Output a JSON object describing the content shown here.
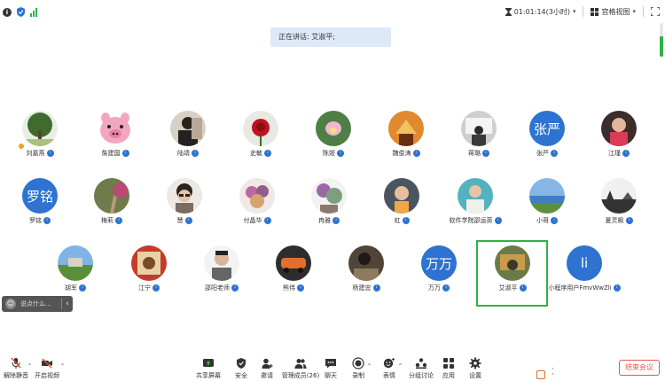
{
  "topbar": {
    "timer": "01:01:14(3小时)",
    "view_label": "宫格视图"
  },
  "speaker_label": "正在讲话: 艾淑平;",
  "participants": [
    {
      "name": "刘嘉燕",
      "avatar": "photo-tree",
      "host": true
    },
    {
      "name": "詹建国",
      "avatar": "pig-cartoon"
    },
    {
      "name": "陆靖",
      "avatar": "photo-person"
    },
    {
      "name": "史敏",
      "avatar": "photo-red-rose"
    },
    {
      "name": "陈姬",
      "avatar": "photo-lotus"
    },
    {
      "name": "魏俊涛",
      "avatar": "photo-temple"
    },
    {
      "name": "蒋璐",
      "avatar": "photo-office"
    },
    {
      "name": "张严",
      "avatar": "initials",
      "initials": "张严"
    },
    {
      "name": "江瑾",
      "avatar": "photo-child"
    },
    {
      "name": "罗铭",
      "avatar": "initials",
      "initials": "罗铭"
    },
    {
      "name": "梅莉",
      "avatar": "photo-path"
    },
    {
      "name": "慧",
      "avatar": "photo-glasses"
    },
    {
      "name": "付晶华",
      "avatar": "photo-flowers"
    },
    {
      "name": "冉雅",
      "avatar": "photo-plants"
    },
    {
      "name": "虹",
      "avatar": "photo-kid"
    },
    {
      "name": "软件学院邵运英",
      "avatar": "photo-woman"
    },
    {
      "name": "小哥",
      "avatar": "photo-sea"
    },
    {
      "name": "夏灵枫",
      "avatar": "photo-sunset"
    },
    {
      "name": "胡军",
      "avatar": "photo-house"
    },
    {
      "name": "江宁",
      "avatar": "photo-painting"
    },
    {
      "name": "邵阳老师",
      "avatar": "photo-man"
    },
    {
      "name": "熊伟",
      "avatar": "photo-car"
    },
    {
      "name": "杨建忠",
      "avatar": "photo-desk"
    },
    {
      "name": "万万",
      "avatar": "initials",
      "initials": "万万"
    },
    {
      "name": "艾淑平",
      "avatar": "photo-garden",
      "active": true
    },
    {
      "name": "小程序用户FmvWwZli",
      "avatar": "initials",
      "initials": "li"
    }
  ],
  "chat_mini": {
    "placeholder": "说点什么..."
  },
  "toolbar": {
    "mute": "解除静音",
    "video": "开启视频",
    "share": "共享屏幕",
    "security": "安全",
    "invite": "邀请",
    "members": "管理成员(26)",
    "chat": "聊天",
    "record": "录制",
    "reactions": "表情",
    "breakout": "分组讨论",
    "apps": "应用",
    "settings": "设置",
    "end": "结束会议"
  },
  "colors": {
    "accent": "#2d73cf",
    "active_border": "#2fb344",
    "end_red": "#e05a4f"
  }
}
